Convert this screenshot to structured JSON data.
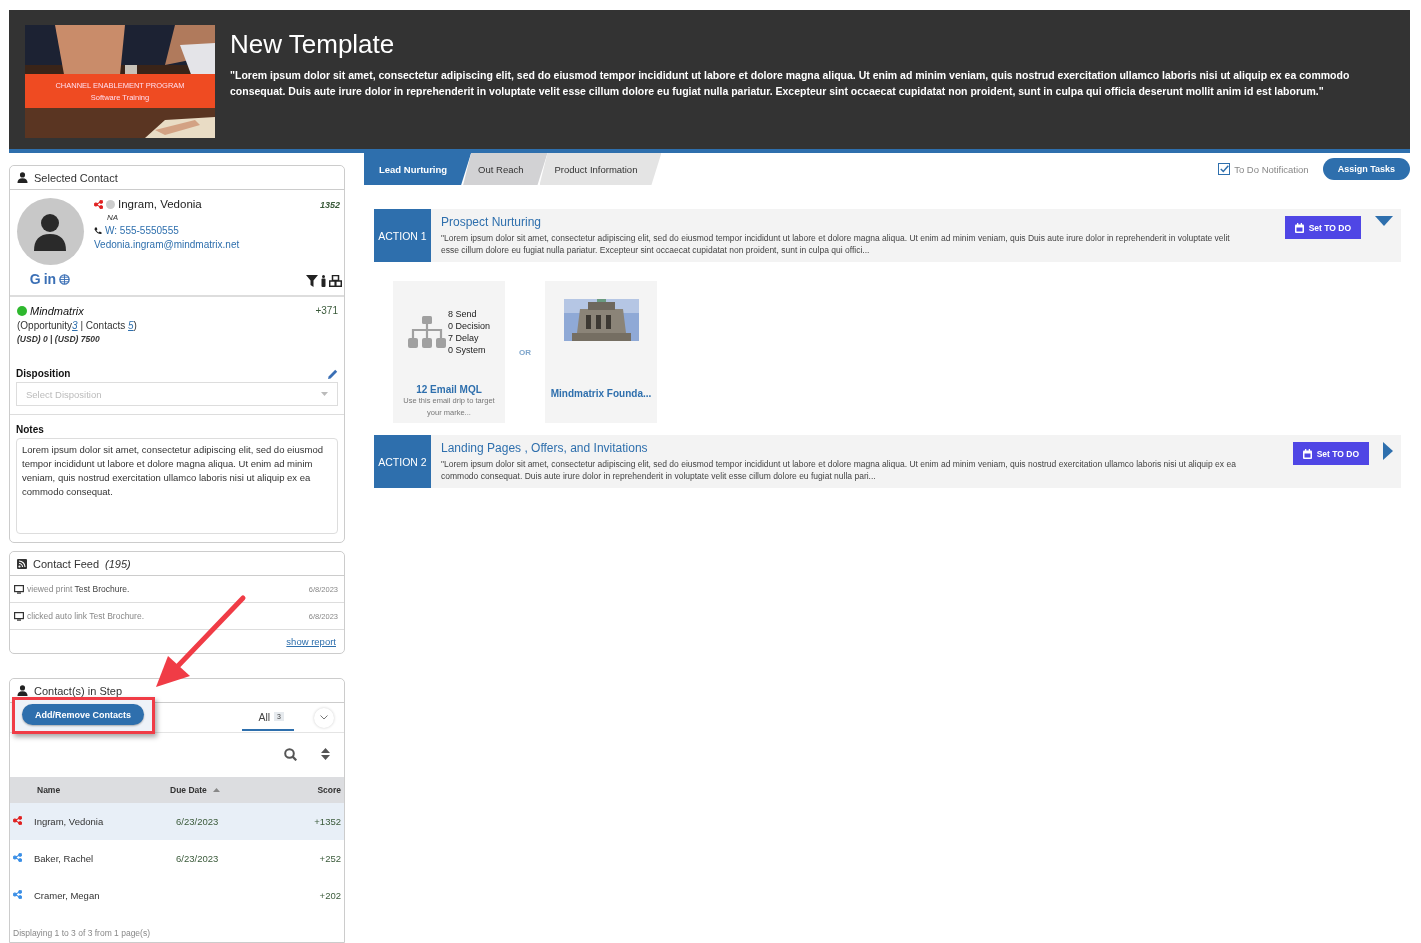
{
  "header": {
    "image": {
      "caption": [
        "CHANNEL ENABLEMENT PROGRAM",
        "Software Training"
      ]
    },
    "title": "New Template",
    "description": "\"Lorem ipsum dolor sit amet, consectetur adipiscing elit, sed do eiusmod tempor incididunt ut labore et dolore magna aliqua. Ut enim ad minim veniam, quis nostrud exercitation ullamco laboris nisi ut aliquip ex ea commodo consequat. Duis aute irure dolor in reprehenderit in voluptate velit esse cillum dolore eu fugiat nulla pariatur. Excepteur sint occaecat cupidatat non proident, sunt in culpa qui officia deserunt mollit anim id est laborum.\""
  },
  "selected_contact": {
    "title": "Selected Contact",
    "name": "Ingram, Vedonia",
    "subtitle": "NA",
    "phone": "W: 555-5550555",
    "email": "Vedonia.ingram@mindmatrix.net",
    "score": "1352",
    "social": [
      "G",
      "in"
    ],
    "company": {
      "name": "Mindmatrix",
      "color": "#2eb82e",
      "score": "+371",
      "open": "(",
      "opportunity_label": "Opportunity",
      "opportunity_count": "3",
      "sep": "|",
      "contacts_label": "Contacts",
      "contacts_count": "5",
      "close": ")",
      "amount_1": "(USD) 0",
      "amount_2": "(USD) 7500"
    },
    "disposition": {
      "label": "Disposition",
      "placeholder": "Select Disposition"
    },
    "notes": {
      "label": "Notes",
      "value": "Lorem ipsum dolor sit amet, consectetur adipiscing elit, sed do eiusmod tempor incididunt ut labore et dolore magna aliqua. Ut enim ad minim veniam, quis nostrud exercitation ullamco laboris nisi ut aliquip ex ea commodo consequat."
    }
  },
  "contact_feed": {
    "title": "Contact Feed",
    "count": "(195)",
    "items": [
      {
        "action": "viewed print",
        "object": "Test Brochure.",
        "date": "6/8/2023"
      },
      {
        "action": "clicked auto link Test Brochure.",
        "date": "6/8/2023"
      }
    ],
    "link": "show report"
  },
  "contacts_in_step": {
    "title": "Contact(s) in Step",
    "add_button": "Add/Remove Contacts",
    "filter": {
      "label": "All",
      "count": "3"
    },
    "columns": [
      "Name",
      "Due Date",
      "Score"
    ],
    "rows": [
      {
        "name": "Ingram, Vedonia",
        "due_date": "6/23/2023",
        "score": "+1352",
        "selected": true,
        "color": "#e02020"
      },
      {
        "name": "Baker, Rachel",
        "due_date": "6/23/2023",
        "score": "+252",
        "selected": false,
        "color": "#3a8ee6"
      },
      {
        "name": "Cramer, Megan",
        "score": "+202",
        "selected": false,
        "color": "#3a8ee6"
      }
    ],
    "footer": "Displaying 1 to 3 of 3 from 1 page(s)"
  },
  "tabs": [
    {
      "label": "Lead Nurturing",
      "selected": true
    },
    {
      "label": "Out Reach",
      "selected": false
    },
    {
      "label": "Product Information",
      "selected": false
    }
  ],
  "todo_notification": {
    "label": "To Do Notification",
    "checked": true
  },
  "assign_button": "Assign Tasks",
  "actions": [
    {
      "badge": "ACTION 1",
      "title": "Prospect Nurturing",
      "description": "\"Lorem ipsum dolor sit amet, consectetur adipiscing elit, sed do eiusmod tempor incididunt ut labore et dolore magna aliqua. Ut enim ad minim veniam, quis Duis aute irure dolor in reprehenderit in voluptate velit esse cillum dolore eu fugiat nulla pariatur. Excepteur sint occaecat cupidatat non proident, sunt in culpa qui offici...",
      "button": "Set TO DO",
      "expanded": true,
      "separator": "OR",
      "assets": [
        {
          "kind": "drip",
          "stats": [
            "8 Send",
            "0 Decision",
            "7 Delay",
            "0 System"
          ],
          "title": "12 Email MQL",
          "description": "Use this email drip to target your marke..."
        },
        {
          "kind": "picture",
          "title": "Mindmatrix Founda..."
        }
      ]
    },
    {
      "badge": "ACTION 2",
      "title": "Landing Pages , Offers, and Invitations",
      "description": "\"Lorem ipsum dolor sit amet, consectetur adipiscing elit, sed do eiusmod tempor incididunt ut labore et dolore magna aliqua. Ut enim ad minim veniam, quis nostrud exercitation ullamco laboris nisi ut aliquip ex ea commodo consequat. Duis aute irure dolor in reprehenderit in voluptate velit esse cillum dolore eu fugiat nulla pari...",
      "button": "Set TO DO",
      "expanded": false
    }
  ]
}
